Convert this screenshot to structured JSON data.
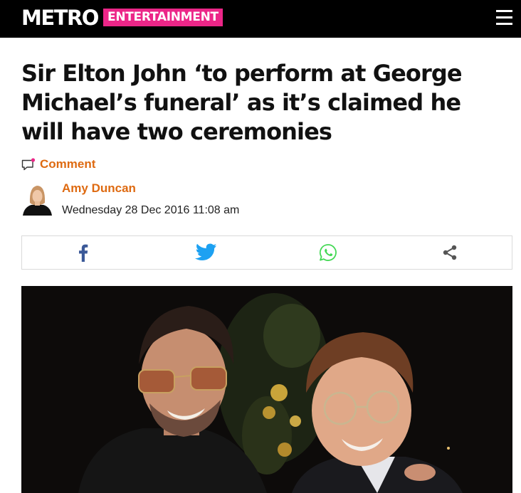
{
  "header": {
    "logo": "METRO",
    "section": "ENTERTAINMENT",
    "menu_icon": "hamburger-menu-icon"
  },
  "article": {
    "headline": "Sir Elton John ‘to perform at George Michael’s funeral’ as it’s claimed he will have two ceremonies",
    "comment_label": "Comment",
    "author": "Amy Duncan",
    "date": "Wednesday 28 Dec 2016 11:08 am"
  },
  "share": {
    "buttons": [
      {
        "icon": "facebook-icon",
        "color": "#3b5998"
      },
      {
        "icon": "twitter-icon",
        "color": "#1da1f2"
      },
      {
        "icon": "whatsapp-icon",
        "color": "#43d854"
      },
      {
        "icon": "share-icon",
        "color": "#555555"
      }
    ]
  },
  "colors": {
    "brand_pink": "#ec2688",
    "byline_orange": "#de6a11",
    "header_bg": "#000000"
  }
}
